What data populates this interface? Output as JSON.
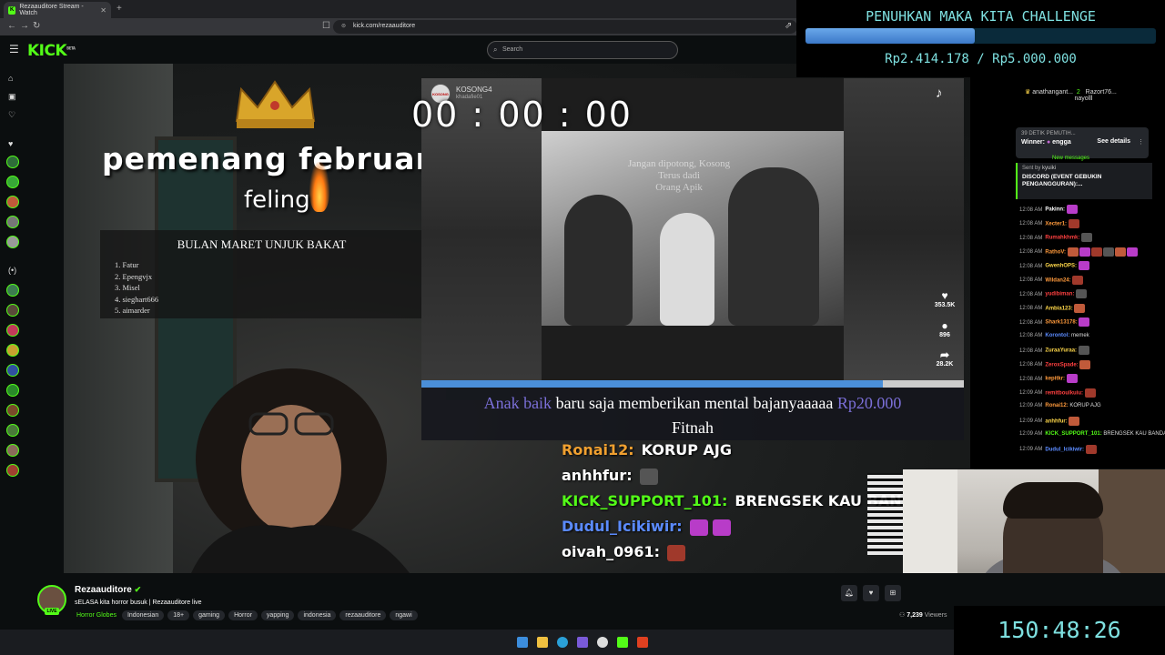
{
  "browser": {
    "tab_title": "Rezaauditore Stream - Watch",
    "url": "kick.com/rezaauditore"
  },
  "kick": {
    "logo": "KICK",
    "logo_badge": "BETA",
    "search_placeholder": "Search"
  },
  "overlay": {
    "goal_title": "PENUHKAN MAKA KITA CHALLENGE",
    "goal_amount": "Rp2.414.178 / Rp5.000.000",
    "goal_progress": 0.4828,
    "uptime": "150:48:26",
    "winner_heading": "pemenang  februari",
    "winner_name": "feling",
    "event_title": "BULAN MARET UNJUK BAKAT",
    "event_list": [
      "1.  Fatur",
      "2.  Epengvjx",
      "3.  Misel",
      "4.  sieghart666",
      "5.  aimarder"
    ],
    "timer": "00 : 00 : 00"
  },
  "tiktok": {
    "username": "KOSONG4",
    "handle": "khadafie01",
    "caption": "Jangan dipotong, Kosong\nTerus dadi\nOrang Apik",
    "likes": "353.5K",
    "comments": "896",
    "shares": "28.2K",
    "progress": 0.85
  },
  "donation_alert": {
    "name": "Anak baik",
    "message_mid": " baru saja memberikan mental bajanyaaaaa ",
    "amount": "Rp20.000",
    "message": "Fitnah"
  },
  "stream_chat_overlay": [
    {
      "user": "Ronai12:",
      "text": "KORUP AJG",
      "color": "#f0a030"
    },
    {
      "user": "anhhfur:",
      "text": "",
      "color": "#ffffff"
    },
    {
      "user": "KICK_SUPPORT_101:",
      "text": "BRENGSEK KAU BAN",
      "color": "#53fc18"
    },
    {
      "user": "Dudul_Icikiwir:",
      "text": "",
      "color": "#5b8bff"
    },
    {
      "user": "oivah_0961:",
      "text": "",
      "color": "#ffffff"
    }
  ],
  "chat": {
    "gifter1": "anathangant...",
    "gifter1_count": "2",
    "gifter2": "Razort76...",
    "gifter3": "nayolll",
    "pinned_small": "39 DETIK PEMUTIH...",
    "pinned_winner_label": "Winner:",
    "pinned_winner": "engga",
    "see_details": "See details",
    "new_messages": "New messages",
    "discord_sent_by": "Sent by",
    "discord_sender": "kyuiki",
    "discord_title": "DISCORD (EVENT GEBUKIN PENGANGGURAN):...",
    "messages": [
      {
        "time": "12:08 AM",
        "user": "Pakinn:",
        "text": "",
        "color": "#ffffff"
      },
      {
        "time": "12:08 AM",
        "user": "Xecter1:",
        "text": "",
        "color": "#ff9a3c"
      },
      {
        "time": "12:08 AM",
        "user": "Rumahkhmk:",
        "text": "",
        "color": "#ff4040"
      },
      {
        "time": "12:08 AM",
        "user": "RathoV:",
        "text": "",
        "color": "#ff9a3c"
      },
      {
        "time": "12:08 AM",
        "user": "GwenhOPS:",
        "text": "",
        "color": "#ffd84a"
      },
      {
        "time": "12:08 AM",
        "user": "Wildan24:",
        "text": "",
        "color": "#ff9a3c"
      },
      {
        "time": "12:08 AM",
        "user": "yudibiman:",
        "text": "",
        "color": "#ff4040"
      },
      {
        "time": "12:08 AM",
        "user": "Ambia123:",
        "text": "",
        "color": "#ffd84a"
      },
      {
        "time": "12:08 AM",
        "user": "Shark13178:",
        "text": "",
        "color": "#ff9a3c"
      },
      {
        "time": "12:08 AM",
        "user": "Korontol:",
        "text": "memek",
        "color": "#5b8bff"
      },
      {
        "time": "12:08 AM",
        "user": "ZuraaYuraa:",
        "text": "",
        "color": "#ffd84a"
      },
      {
        "time": "12:08 AM",
        "user": "ZeroxSpade:",
        "text": "",
        "color": "#ff4040"
      },
      {
        "time": "12:08 AM",
        "user": "kepitkr:",
        "text": "",
        "color": "#ff9a3c"
      },
      {
        "time": "12:09 AM",
        "user": "remitboulkuiu:",
        "text": "",
        "color": "#ff4040"
      },
      {
        "time": "12:09 AM",
        "user": "Ronai12:",
        "text": "KORUP AJG",
        "color": "#ff9a3c"
      },
      {
        "time": "12:09 AM",
        "user": "anhhfur:",
        "text": "",
        "color": "#ffd84a"
      },
      {
        "time": "12:09 AM",
        "user": "KICK_SUPPORT_101:",
        "text": "BRENGSEK KAU BANDAR",
        "color": "#53fc18"
      },
      {
        "time": "12:09 AM",
        "user": "Dudul_Icikiwir:",
        "text": "",
        "color": "#5b8bff"
      }
    ]
  },
  "stream_info": {
    "channel": "Rezaauditore",
    "live_badge": "LIVE",
    "title": "sELASA kita horror busuk | Rezaauditore live",
    "category": "Horror Globes",
    "tags": [
      "Indonesian",
      "18+",
      "gaming",
      "Horror",
      "yapping",
      "indonesia",
      "rezaauditore",
      "ngawi"
    ],
    "viewers": "7,239",
    "viewers_label": "Viewers"
  },
  "colors": {
    "kick_green": "#53fc18",
    "overlay_cyan": "#7ee0e0",
    "goal_blue": "#3b78c8"
  }
}
